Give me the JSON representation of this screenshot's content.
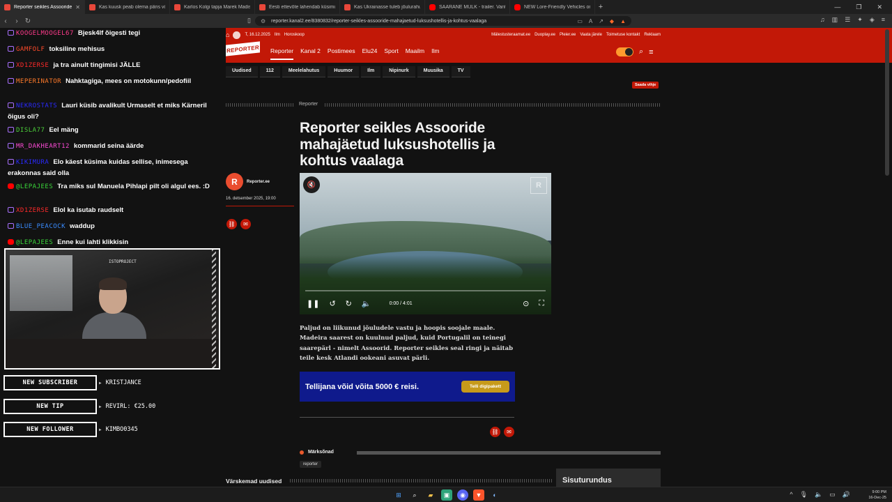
{
  "browser": {
    "tabs": [
      {
        "label": "Reporter seikles Assooride mahaj",
        "active": true,
        "icon": "reporter-favicon"
      },
      {
        "label": "Kas kuusk peab olema päris või sobib",
        "active": false,
        "icon": "reporter-favicon"
      },
      {
        "label": "Karlos Kolgi tapja Marek Madisoo l",
        "active": false,
        "icon": "reporter-favicon"
      },
      {
        "label": "Eesti ettevõte lahendab küsimust, ku",
        "active": false,
        "icon": "reporter-favicon"
      },
      {
        "label": "Kas Ukrainasse tuleb jõulurahu?",
        "active": false,
        "icon": "reporter-favicon"
      },
      {
        "label": "SÄÄRANE MULK - trailer. Vanti kinod",
        "active": false,
        "icon": "youtube-favicon"
      },
      {
        "label": "NEW Lore-Friendly Vehicles on FiveM",
        "active": false,
        "icon": "youtube-favicon"
      }
    ],
    "new_tab": "+",
    "url": "reporter.kanal2.ee/8380832/reporter-seikles-assooride-mahajaetud-luksushotellis-ja-kohtus-vaalaga"
  },
  "chat": [
    {
      "user": "KOOGELMOOGEL67",
      "user_color": "#ff3b8b",
      "badge": "twitch",
      "msg": "Bjesk4lf õigesti tegi"
    },
    {
      "user": "GAMFOLF",
      "user_color": "#ff4b2b",
      "badge": "twitch",
      "msg": "toksiline mehisus"
    },
    {
      "user": "XD1ZERSE",
      "user_color": "#ff2a2a",
      "badge": "twitch",
      "msg": "ja tra ainult tingimisi JÄLLE"
    },
    {
      "user": "MEPERINATOR",
      "user_color": "#ff7a2a",
      "badge": "twitch",
      "msg": "Nahktagiga, mees on motokunn/pedofiil"
    },
    {
      "user": "NEKROSTATS",
      "user_color": "#2a2aff",
      "badge": "twitch",
      "msg": "Lauri küsib avalikult Urmaselt et miks Kärneril õigus oli?"
    },
    {
      "user": "DISLA77",
      "user_color": "#4ccf3a",
      "badge": "twitch",
      "msg": "Eel mäng"
    },
    {
      "user": "MR_DAKHEART12",
      "user_color": "#ff4bd8",
      "badge": "twitch",
      "msg": "kommarid seina äärde"
    },
    {
      "user": "KIKIMURA",
      "user_color": "#2a2aff",
      "badge": "twitch",
      "msg": "Elo käest küsima kuidas sellise, inimesega erakonnas said olla"
    },
    {
      "user": "@LEPAJEES",
      "user_color": "#3ad63a",
      "badge": "youtube",
      "msg": "Tra miks sul Manuela Pihlapi pilt oli algul ees. :D"
    },
    {
      "user": "XD1ZERSE",
      "user_color": "#ff2a2a",
      "badge": "twitch",
      "msg": "Elol ka isutab raudselt"
    },
    {
      "user": "BLUE_PEACOCK",
      "user_color": "#3a8cff",
      "badge": "twitch",
      "msg": "waddup"
    },
    {
      "user": "@LEPAJEES",
      "user_color": "#3ad63a",
      "badge": "youtube",
      "msg": "Enne kui lahti klikkisin"
    }
  ],
  "stream": {
    "cam_tag": "ISTOPROJECT",
    "alerts": [
      {
        "label": "NEW SUBSCRIBER",
        "value": "KRISTJANCE"
      },
      {
        "label": "NEW TIP",
        "value": "REVIRL: €25.00"
      },
      {
        "label": "NEW FOLLOWER",
        "value": "KIMBO0345"
      }
    ]
  },
  "site": {
    "date": "T, 16.12.2025",
    "weather_link": "Ilm",
    "horoscope_link": "Horoskoop",
    "top_links": [
      "Mälestusteraamat.ee",
      "Duoplay.ee",
      "Pleier.ee",
      "Vaata järele",
      "Toimetuse kontakt",
      "Reklaam"
    ],
    "logo": "REPORTER",
    "main_nav": [
      "Reporter",
      "Kanal 2",
      "Postimees",
      "Elu24",
      "Sport",
      "Maailm",
      "Ilm"
    ],
    "sub_nav": [
      "Uudised",
      "112",
      "Meelelahutus",
      "Huumor",
      "Ilm",
      "Nipinurk",
      "Muusika",
      "TV"
    ],
    "send_tip": "Saada vihje"
  },
  "article": {
    "section": "Reporter",
    "title": "Reporter seikles Assooride mahajäetud luksushotellis ja kohtus vaalaga",
    "author": "Reporter.ee",
    "author_initial": "R",
    "published": "16. detsember 2025, 19:00",
    "video": {
      "time": "0:00 / 4:01",
      "progress": 0
    },
    "lead": "Paljud on liikunud jõuludele vastu ja hoopis soojale maale. Madeira saarest on kuulnud paljud, kuid Portugalil on teinegi saarepärl - nimelt Assoorid. Reporter seikles seal ringi ja näitab teile kesk Atlandi ookeani asuvat pärli.",
    "promo_text": "Tellijana võid võita 5000 € reisi.",
    "promo_button": "Telli digipakett",
    "tags_header": "Märksõnad",
    "tags": [
      "reporter"
    ],
    "latest_header": "Värskemad uudised",
    "sidebox_title": "Sisuturundus"
  },
  "taskbar": {
    "time": "9:00 PM",
    "date": "16-Dec-25"
  },
  "colors": {
    "brand_red": "#c21807",
    "promo_blue": "#0f1a8c",
    "promo_gold": "#c79a1a"
  }
}
